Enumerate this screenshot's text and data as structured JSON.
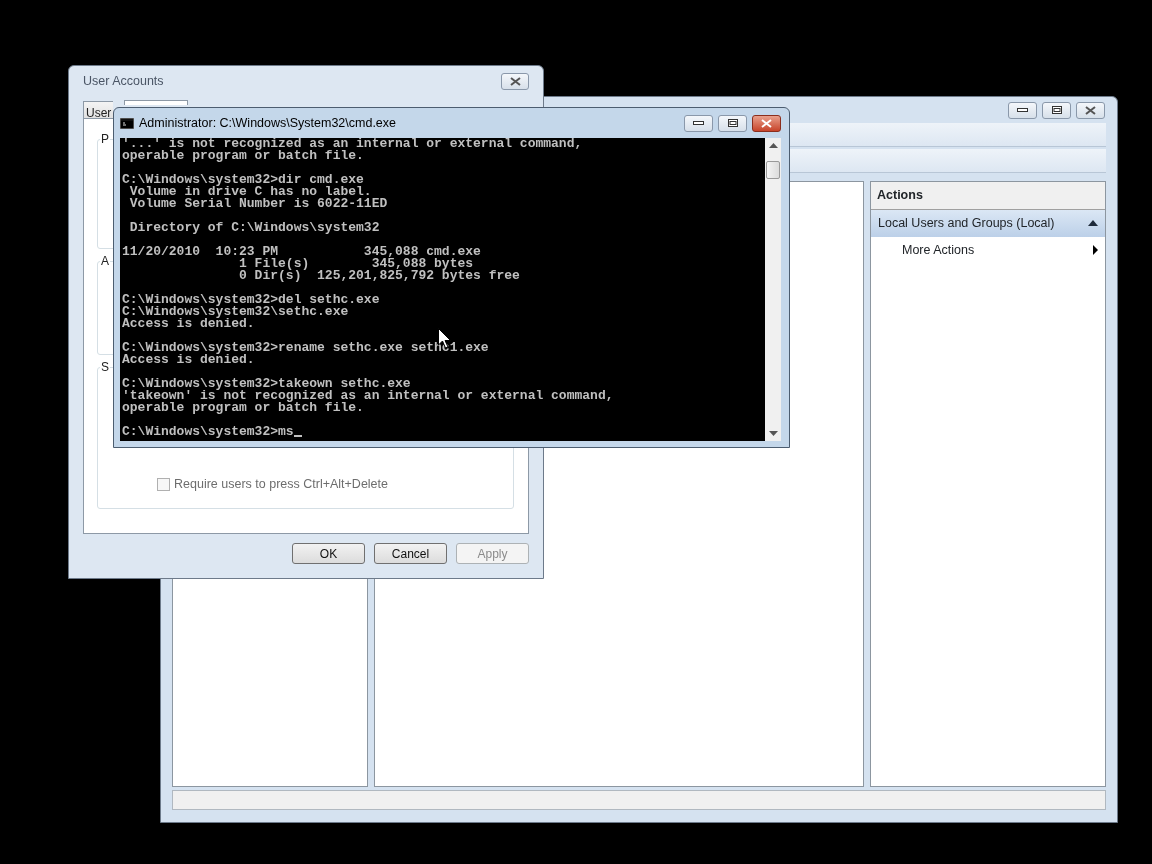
{
  "mmc_window": {
    "actions": {
      "header": "Actions",
      "items": [
        {
          "kind": "section",
          "label": "Local Users and Groups (Local)",
          "selected": true,
          "expanded": true
        },
        {
          "kind": "submenu",
          "label": "More Actions",
          "selected": false
        }
      ]
    }
  },
  "dialog": {
    "title": "User Accounts",
    "tabs": [
      {
        "label": "User",
        "selected": false
      },
      {
        "selected": true
      }
    ],
    "groups": [
      {
        "legend": "P"
      },
      {
        "legend": "A"
      },
      {
        "legend": "S",
        "checkbox": {
          "label": "Require users to press Ctrl+Alt+Delete",
          "checked": false,
          "disabled": true
        }
      }
    ],
    "buttons": [
      {
        "label": "OK",
        "disabled": false
      },
      {
        "label": "Cancel",
        "disabled": false
      },
      {
        "label": "Apply",
        "disabled": true
      }
    ]
  },
  "console": {
    "title": "Administrator: C:\\Windows\\System32\\cmd.exe",
    "blocks": [
      [
        "'...' is not recognized as an internal or external command,",
        "operable program or batch file."
      ],
      [
        "C:\\Windows\\system32>dir cmd.exe",
        " Volume in drive C has no label.",
        " Volume Serial Number is 6022-11ED"
      ],
      [
        " Directory of C:\\Windows\\system32"
      ],
      [
        "11/20/2010  10:23 PM           345,088 cmd.exe",
        "               1 File(s)        345,088 bytes",
        "               0 Dir(s)  125,201,825,792 bytes free"
      ],
      [
        "C:\\Windows\\system32>del sethc.exe",
        "C:\\Windows\\system32\\sethc.exe",
        "Access is denied."
      ],
      [
        "C:\\Windows\\system32>rename sethc.exe sethc1.exe",
        "Access is denied."
      ],
      [
        "C:\\Windows\\system32>takeown sethc.exe",
        "'takeown' is not recognized as an internal or external command,",
        "operable program or batch file."
      ]
    ],
    "prompt": "C:\\Windows\\system32>ms",
    "cursor_visible": true
  }
}
